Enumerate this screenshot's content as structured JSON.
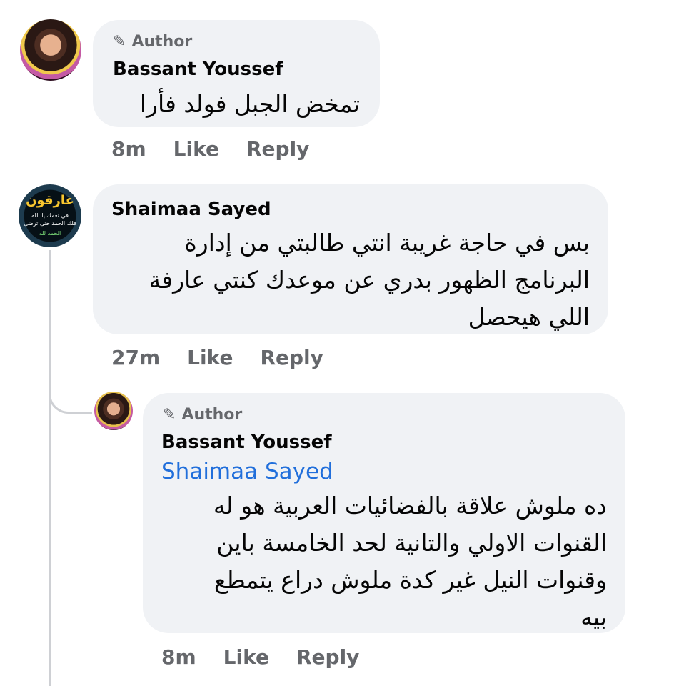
{
  "comments": [
    {
      "badge": "Author",
      "name": "Bassant Youssef",
      "text": "تمخض الجبل فولد فأرا",
      "time": "8m",
      "like": "Like",
      "reply": "Reply"
    },
    {
      "badge": "",
      "name": "Shaimaa Sayed",
      "text_lines": [
        "بس في حاجة غريبة انتي طالبتي من إدارة",
        "البرنامج الظهور بدري عن موعدك كنتي عارفة",
        "اللي هيحصل"
      ],
      "time": "27m",
      "like": "Like",
      "reply": "Reply",
      "avatar_text": [
        "غارقون",
        "في نعمك يا الله",
        "فلك الحمد حتى ترضى",
        "الحمد لله"
      ]
    },
    {
      "badge": "Author",
      "name": "Bassant Youssef",
      "mention": "Shaimaa Sayed",
      "text_lines": [
        "ده ملوش علاقة بالفضائيات العربية هو له",
        "القنوات الاولي والتانية لحد الخامسة باين",
        "وقنوات النيل غير كدة ملوش دراع يتمطع",
        "بيه"
      ],
      "time": "8m",
      "like": "Like",
      "reply": "Reply"
    }
  ]
}
